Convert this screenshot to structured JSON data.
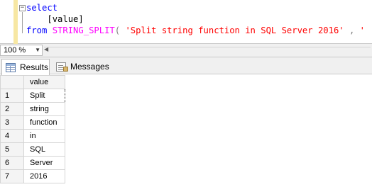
{
  "editor": {
    "line1": {
      "kw": "select"
    },
    "line2": {
      "ident": "[value]"
    },
    "line3": {
      "kw": "from",
      "fn": "STRING_SPLIT",
      "open": "(",
      "str1": "'Split string function in SQL Server 2016'",
      "comma": ",",
      "str2": "' '",
      "close": ")"
    }
  },
  "zoom": {
    "value": "100 %"
  },
  "tabs": [
    {
      "label": "Results",
      "icon": "grid-icon",
      "active": true
    },
    {
      "label": "Messages",
      "icon": "messages-icon",
      "active": false
    }
  ],
  "results": {
    "column": "value",
    "rows": [
      {
        "num": "1",
        "value": "Split"
      },
      {
        "num": "2",
        "value": "string"
      },
      {
        "num": "3",
        "value": "function"
      },
      {
        "num": "4",
        "value": "in"
      },
      {
        "num": "5",
        "value": "SQL"
      },
      {
        "num": "6",
        "value": "Server"
      },
      {
        "num": "7",
        "value": "2016"
      }
    ]
  },
  "colors": {
    "keyword": "#0000ff",
    "function": "#ff00ff",
    "string": "#ff0000",
    "gutter": "#f7e7a3"
  }
}
